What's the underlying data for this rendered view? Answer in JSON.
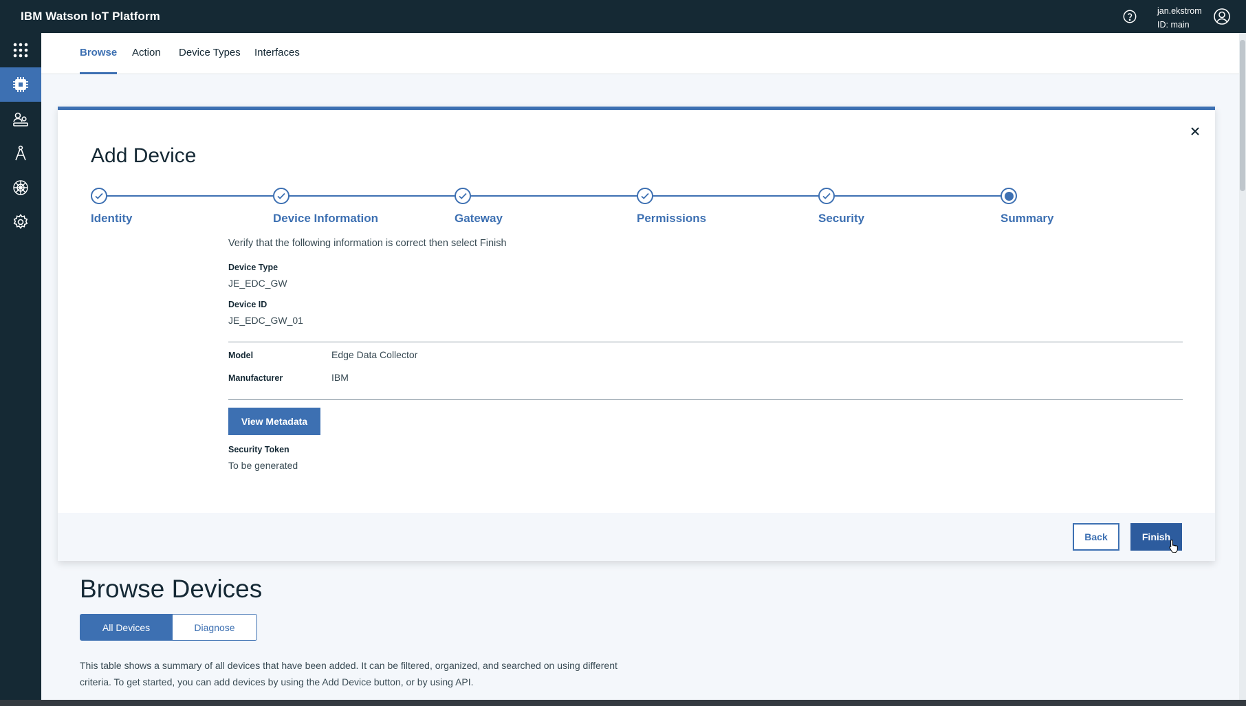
{
  "header": {
    "title": "IBM Watson IoT Platform",
    "user_name": "jan.ekstrom",
    "user_id": "ID: main",
    "help_icon": "help-icon",
    "user_icon": "user-avatar-icon"
  },
  "siderail": {
    "items": [
      {
        "icon": "app-grid-icon"
      },
      {
        "icon": "devices-chip-icon",
        "active": true
      },
      {
        "icon": "members-icon"
      },
      {
        "icon": "apps-compass-icon"
      },
      {
        "icon": "rules-network-icon"
      },
      {
        "icon": "settings-gear-icon"
      }
    ]
  },
  "subnav": {
    "tabs": [
      {
        "label": "Browse",
        "active": true
      },
      {
        "label": "Action"
      },
      {
        "label": "Device Types"
      },
      {
        "label": "Interfaces"
      }
    ]
  },
  "modal": {
    "title": "Add Device",
    "steps": [
      {
        "label": "Identity",
        "state": "complete"
      },
      {
        "label": "Device Information",
        "state": "complete"
      },
      {
        "label": "Gateway",
        "state": "complete"
      },
      {
        "label": "Permissions",
        "state": "complete"
      },
      {
        "label": "Security",
        "state": "complete"
      },
      {
        "label": "Summary",
        "state": "current"
      }
    ],
    "verify_text": "Verify that the following information is correct then select Finish",
    "device_type_label": "Device Type",
    "device_type_value": "JE_EDC_GW",
    "device_id_label": "Device ID",
    "device_id_value": "JE_EDC_GW_01",
    "model_label": "Model",
    "model_value": "Edge Data Collector",
    "manufacturer_label": "Manufacturer",
    "manufacturer_value": "IBM",
    "view_metadata_label": "View Metadata",
    "security_token_label": "Security Token",
    "security_token_value": "To be generated",
    "back_label": "Back",
    "finish_label": "Finish"
  },
  "page": {
    "title": "Browse Devices",
    "toggle_all": "All Devices",
    "toggle_diagnose": "Diagnose",
    "description": "This table shows a summary of all devices that have been added. It can be filtered, organized, and searched on using different criteria. To get started, you can add devices by using the Add Device button, or by using API."
  },
  "colors": {
    "header_bg": "#152934",
    "accent": "#3d70b2"
  }
}
